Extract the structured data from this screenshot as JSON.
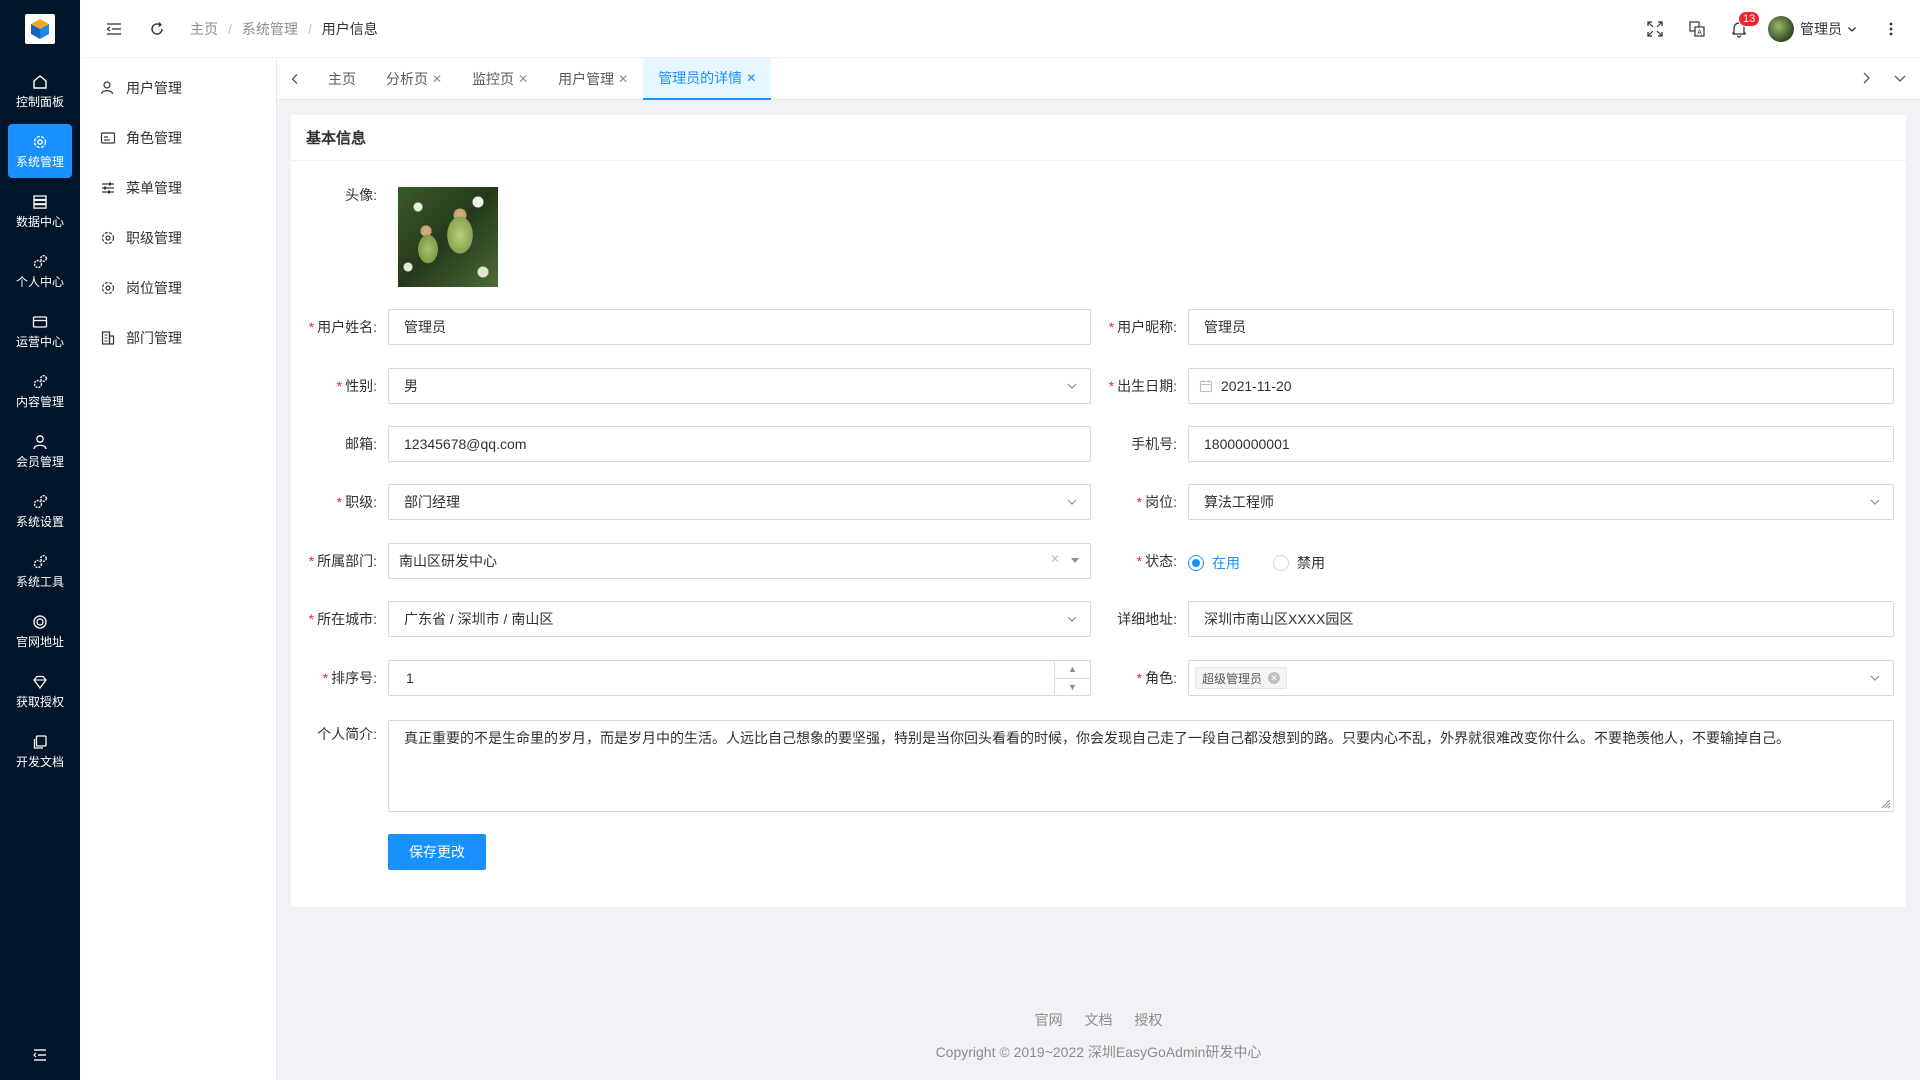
{
  "rail": {
    "items": [
      {
        "label": "控制面板",
        "icon": "home-icon"
      },
      {
        "label": "系统管理",
        "icon": "gear-icon",
        "active": true
      },
      {
        "label": "数据中心",
        "icon": "database-icon"
      },
      {
        "label": "个人中心",
        "icon": "cogs-icon"
      },
      {
        "label": "运营中心",
        "icon": "card-icon"
      },
      {
        "label": "内容管理",
        "icon": "cogs-icon"
      },
      {
        "label": "会员管理",
        "icon": "user-icon"
      },
      {
        "label": "系统设置",
        "icon": "cogs-icon"
      },
      {
        "label": "系统工具",
        "icon": "cogs-icon"
      },
      {
        "label": "官网地址",
        "icon": "globe-icon"
      },
      {
        "label": "获取授权",
        "icon": "diamond-icon"
      },
      {
        "label": "开发文档",
        "icon": "copy-icon"
      }
    ]
  },
  "submenu": {
    "items": [
      {
        "label": "用户管理",
        "icon": "user-icon"
      },
      {
        "label": "角色管理",
        "icon": "id-card-icon"
      },
      {
        "label": "菜单管理",
        "icon": "sliders-icon"
      },
      {
        "label": "职级管理",
        "icon": "gear-icon"
      },
      {
        "label": "岗位管理",
        "icon": "gear-icon"
      },
      {
        "label": "部门管理",
        "icon": "building-icon"
      }
    ]
  },
  "header": {
    "breadcrumb": [
      "主页",
      "系统管理",
      "用户信息"
    ],
    "notification_count": "13",
    "user_name": "管理员"
  },
  "tabs": [
    {
      "label": "主页",
      "closable": false
    },
    {
      "label": "分析页",
      "closable": true
    },
    {
      "label": "监控页",
      "closable": true
    },
    {
      "label": "用户管理",
      "closable": true
    },
    {
      "label": "管理员的详情",
      "closable": true,
      "active": true
    }
  ],
  "form": {
    "title": "基本信息",
    "labels": {
      "avatar": "头像:",
      "realname": "用户姓名:",
      "nickname": "用户昵称:",
      "gender": "性别:",
      "birthday": "出生日期:",
      "email": "邮箱:",
      "mobile": "手机号:",
      "level": "职级:",
      "position": "岗位:",
      "dept": "所属部门:",
      "status": "状态:",
      "city": "所在城市:",
      "address": "详细地址:",
      "sort": "排序号:",
      "role": "角色:",
      "intro": "个人简介:"
    },
    "values": {
      "realname": "管理员",
      "nickname": "管理员",
      "gender": "男",
      "birthday": "2021-11-20",
      "email": "12345678@qq.com",
      "mobile": "18000000001",
      "level": "部门经理",
      "position": "算法工程师",
      "dept": "南山区研发中心",
      "status_on": "在用",
      "status_off": "禁用",
      "city": "广东省 / 深圳市 / 南山区",
      "address": "深圳市南山区XXXX园区",
      "sort": "1",
      "role_tag": "超级管理员",
      "intro": "真正重要的不是生命里的岁月，而是岁月中的生活。人远比自己想象的要坚强，特别是当你回头看看的时候，你会发现自己走了一段自己都没想到的路。只要内心不乱，外界就很难改变你什么。不要艳羡他人，不要输掉自己。"
    },
    "save_label": "保存更改"
  },
  "footer": {
    "links": [
      "官网",
      "文档",
      "授权"
    ],
    "copyright": "Copyright © 2019~2022 深圳EasyGoAdmin研发中心"
  },
  "colors": {
    "primary": "#1890ff",
    "rail_bg": "#001529",
    "danger": "#f5222d"
  }
}
